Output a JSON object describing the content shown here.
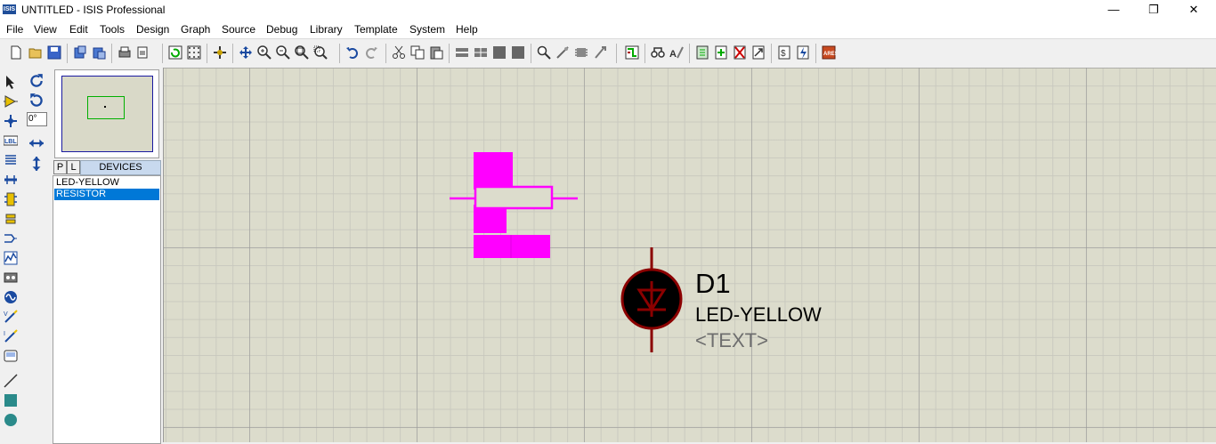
{
  "titlebar": {
    "logo_text": "ISIS",
    "title": "UNTITLED - ISIS Professional",
    "minimize": "—",
    "maximize": "❐",
    "close": "✕"
  },
  "menu": [
    "File",
    "View",
    "Edit",
    "Tools",
    "Design",
    "Graph",
    "Source",
    "Debug",
    "Library",
    "Template",
    "System",
    "Help"
  ],
  "rotation": {
    "angle": "0°"
  },
  "devices_panel": {
    "p_button": "P",
    "l_button": "L",
    "header": "DEVICES",
    "items": [
      "LED-YELLOW",
      "RESISTOR"
    ],
    "selected_index": 1
  },
  "schematic": {
    "component_ref": "D1",
    "component_value": "LED-YELLOW",
    "component_text": "<TEXT>",
    "colors": {
      "wire": "#8b0000",
      "led_fill": "#000000",
      "preview": "#ff00ff",
      "canvas": "#dcdccc"
    }
  },
  "icons": {
    "toolbar": [
      "new-file-icon",
      "open-file-icon",
      "save-icon",
      "import-icon",
      "export-icon",
      "print-icon",
      "print-area-icon",
      "refresh-icon",
      "grid-icon",
      "origin-icon",
      "pan-icon",
      "zoom-in-icon",
      "zoom-out-icon",
      "zoom-all-icon",
      "zoom-area-icon",
      "undo-icon",
      "redo-icon",
      "cut-icon",
      "copy-icon",
      "paste-icon",
      "block-copy-icon",
      "block-move-icon",
      "block-rotate-icon",
      "block-delete-icon",
      "pick-device-icon",
      "make-device-icon",
      "packaging-tool-icon",
      "decompose-icon",
      "wire-autorouter-icon",
      "search-tag-icon",
      "property-assignment-icon",
      "new-sheet-icon",
      "add-sheet-icon",
      "remove-sheet-icon",
      "exit-parent-icon",
      "bill-of-materials-icon",
      "electrical-check-icon",
      "netlist-ares-icon"
    ],
    "left": [
      "selection-mode-icon",
      "component-mode-icon",
      "junction-dot-icon",
      "wire-label-icon",
      "text-script-icon",
      "bus-icon",
      "subcircuit-icon",
      "terminal-icon",
      "device-pin-icon",
      "graph-icon",
      "tape-recorder-icon",
      "generator-icon",
      "voltage-probe-icon",
      "current-probe-icon",
      "virtual-instrument-icon",
      "line-icon",
      "box-icon",
      "circle-icon"
    ],
    "rotate": [
      "rotate-clockwise-icon",
      "rotate-anticlockwise-icon",
      "mirror-horizontal-icon",
      "mirror-vertical-icon"
    ]
  }
}
